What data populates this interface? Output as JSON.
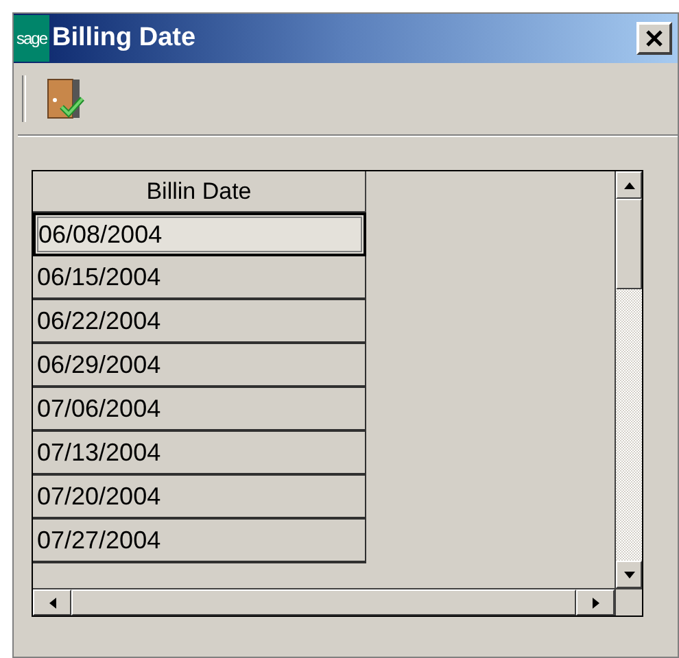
{
  "window": {
    "title": "Billing Date",
    "logo": "sage"
  },
  "grid": {
    "columns": [
      "Billin Date"
    ],
    "rows": [
      {
        "date": "06/08/2004",
        "selected": true
      },
      {
        "date": "06/15/2004",
        "selected": false
      },
      {
        "date": "06/22/2004",
        "selected": false
      },
      {
        "date": "06/29/2004",
        "selected": false
      },
      {
        "date": "07/06/2004",
        "selected": false
      },
      {
        "date": "07/13/2004",
        "selected": false
      },
      {
        "date": "07/20/2004",
        "selected": false
      },
      {
        "date": "07/27/2004",
        "selected": false
      }
    ]
  }
}
